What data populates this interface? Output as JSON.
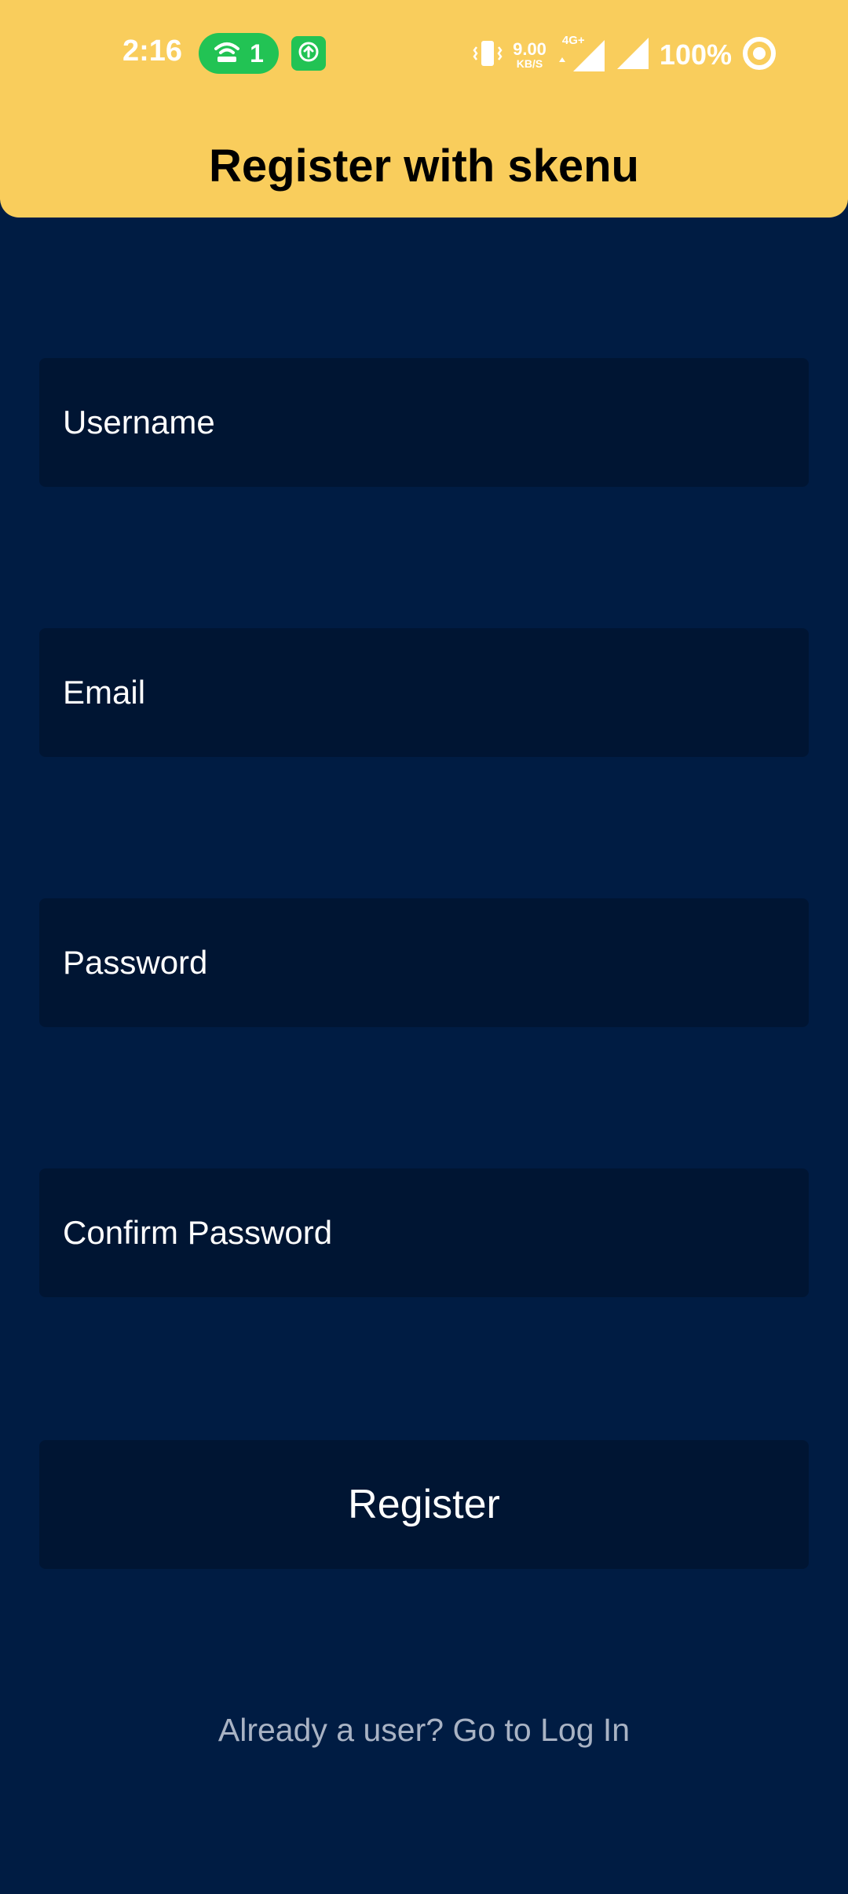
{
  "status_bar": {
    "time": "2:16",
    "hotspot_count": "1",
    "net_speed_value": "9.00",
    "net_speed_unit": "KB/S",
    "network_type": "4G+",
    "battery": "100%",
    "icons": [
      "hotspot-icon",
      "upload-icon",
      "vibrate-icon",
      "signal-icon",
      "signal-icon",
      "ring-icon"
    ]
  },
  "header": {
    "title": "Register with skenu"
  },
  "form": {
    "username_placeholder": "Username",
    "email_placeholder": "Email",
    "password_placeholder": "Password",
    "confirm_password_placeholder": "Confirm Password",
    "register_label": "Register"
  },
  "footer": {
    "login_link": "Already a user? Go to Log In"
  },
  "colors": {
    "header_bg": "#f9cd5c",
    "page_bg": "#001c43",
    "field_bg": "#001533",
    "accent_green": "#22c354"
  }
}
